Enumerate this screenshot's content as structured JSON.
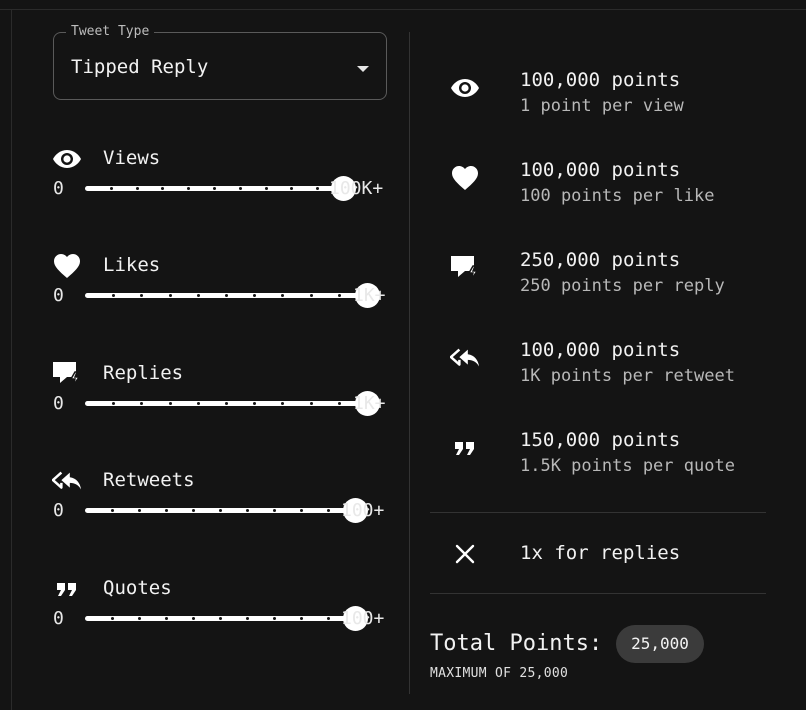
{
  "tweet_type": {
    "legend": "Tweet Type",
    "value": "Tipped Reply"
  },
  "metrics": [
    {
      "label": "Views",
      "icon": "eye-icon",
      "min": "0",
      "max": "100K+",
      "level": 1.0
    },
    {
      "label": "Likes",
      "icon": "heart-icon",
      "min": "0",
      "max": "1K+",
      "level": 1.0
    },
    {
      "label": "Replies",
      "icon": "reply-icon",
      "min": "0",
      "max": "1K+",
      "level": 1.0
    },
    {
      "label": "Retweets",
      "icon": "retweet-icon",
      "min": "0",
      "max": "100+",
      "level": 1.0
    },
    {
      "label": "Quotes",
      "icon": "quote-icon",
      "min": "0",
      "max": "100+",
      "level": 1.0
    }
  ],
  "points": [
    {
      "icon": "eye-icon",
      "title": "100,000 points",
      "sub": "1 point per view"
    },
    {
      "icon": "heart-icon",
      "title": "100,000 points",
      "sub": "100 points per like"
    },
    {
      "icon": "reply-icon",
      "title": "250,000 points",
      "sub": "250 points per reply"
    },
    {
      "icon": "retweet-icon",
      "title": "100,000 points",
      "sub": "1K points per retweet"
    },
    {
      "icon": "quote-icon",
      "title": "150,000 points",
      "sub": "1.5K points per quote"
    }
  ],
  "multiplier": {
    "icon": "close-icon",
    "text": "1x for replies"
  },
  "total": {
    "label": "Total Points:",
    "value": "25,000",
    "note": "MAXIMUM OF 25,000"
  },
  "colors": {
    "background": "#141414",
    "text": "#ededed",
    "chip": "#3b3b3b"
  }
}
